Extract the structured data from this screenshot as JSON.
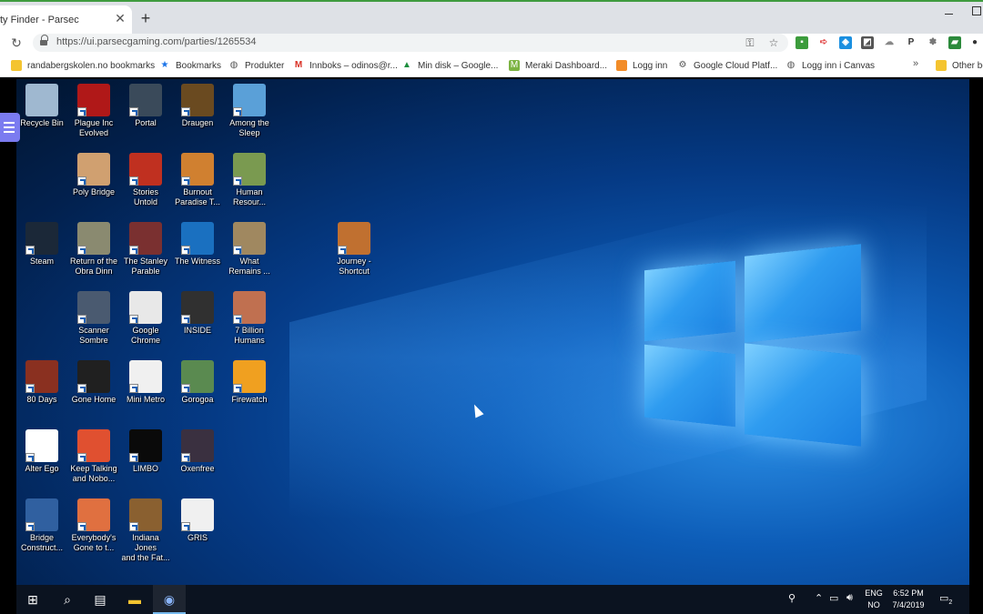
{
  "browser": {
    "tab_title": "ty Finder - Parsec",
    "new_tab": "+",
    "close": "✕",
    "url": "https://ui.parsecgaming.com/parties/1265534",
    "reload": "↻"
  },
  "bookmarks": [
    {
      "label": "randabergskolen.no bookmarks",
      "icon": "folder-icon",
      "color": "#f4c430"
    },
    {
      "label": "Bookmarks",
      "icon": "star-icon",
      "color": "#1a73e8"
    },
    {
      "label": "Produkter",
      "icon": "globe-icon",
      "color": "#555555"
    },
    {
      "label": "Innboks – odinos@r...",
      "icon": "gmail-icon",
      "color": "#d93025"
    },
    {
      "label": "Min disk – Google...",
      "icon": "drive-icon",
      "color": "#1e8e3e"
    },
    {
      "label": "Meraki Dashboard...",
      "icon": "meraki-icon",
      "color": "#7cb342"
    },
    {
      "label": "Logg inn",
      "icon": "basket-icon",
      "color": "#f28c28"
    },
    {
      "label": "Google Cloud Platf...",
      "icon": "gear-icon",
      "color": "#555555"
    },
    {
      "label": "Logg inn i Canvas",
      "icon": "globe-icon",
      "color": "#555555"
    },
    {
      "label": "Other bo",
      "icon": "folder-icon",
      "color": "#f4c430"
    }
  ],
  "bookmarks_more": "»",
  "desktop_icons": [
    {
      "label": "Recycle Bin",
      "color": "#9fb8d0"
    },
    {
      "label": "Plague Inc\nEvolved",
      "color": "#b01818"
    },
    {
      "label": "Portal",
      "color": "#3a4a5a"
    },
    {
      "label": "Draugen",
      "color": "#6a4a20"
    },
    {
      "label": "Among the\nSleep",
      "color": "#5aa0d8"
    },
    {
      "label": "Poly Bridge",
      "color": "#d0a070"
    },
    {
      "label": "Stories\nUntold",
      "color": "#c03020"
    },
    {
      "label": "Burnout\nParadise T...",
      "color": "#d08030"
    },
    {
      "label": "Human\nResour...",
      "color": "#7a9a50"
    },
    {
      "label": "Steam",
      "color": "#1b2838"
    },
    {
      "label": "Return of the\nObra Dinn",
      "color": "#8a8a70"
    },
    {
      "label": "The Stanley\nParable",
      "color": "#7a3030"
    },
    {
      "label": "The Witness",
      "color": "#1a70c0"
    },
    {
      "label": "What\nRemains ...",
      "color": "#a08860"
    },
    {
      "label": "Journey -\nShortcut",
      "color": "#c07030"
    },
    {
      "label": "Scanner\nSombre",
      "color": "#4a5a70"
    },
    {
      "label": "Google\nChrome",
      "color": "#e8e8e8"
    },
    {
      "label": "INSIDE",
      "color": "#303030"
    },
    {
      "label": "7 Billion\nHumans",
      "color": "#c07050"
    },
    {
      "label": "80 Days",
      "color": "#8a3020"
    },
    {
      "label": "Gone Home",
      "color": "#202020"
    },
    {
      "label": "Mini Metro",
      "color": "#f0f0f0"
    },
    {
      "label": "Gorogoa",
      "color": "#5a8a50"
    },
    {
      "label": "Firewatch",
      "color": "#f0a020"
    },
    {
      "label": "Alter Ego",
      "color": "#ffffff"
    },
    {
      "label": "Keep Talking\nand Nobo...",
      "color": "#e05030"
    },
    {
      "label": "LIMBO",
      "color": "#0a0a0a"
    },
    {
      "label": "Oxenfree",
      "color": "#3a3040"
    },
    {
      "label": "Bridge\nConstruct...",
      "color": "#3060a0"
    },
    {
      "label": "Everybody's\nGone to t...",
      "color": "#e07040"
    },
    {
      "label": "Indiana Jones\nand the Fat...",
      "color": "#8a6030"
    },
    {
      "label": "GRIS",
      "color": "#f0f0f0"
    }
  ],
  "taskbar": {
    "lang_line1": "ENG",
    "lang_line2": "NO",
    "time": "6:52 PM",
    "date": "7/4/2019",
    "notification_count": "2"
  }
}
